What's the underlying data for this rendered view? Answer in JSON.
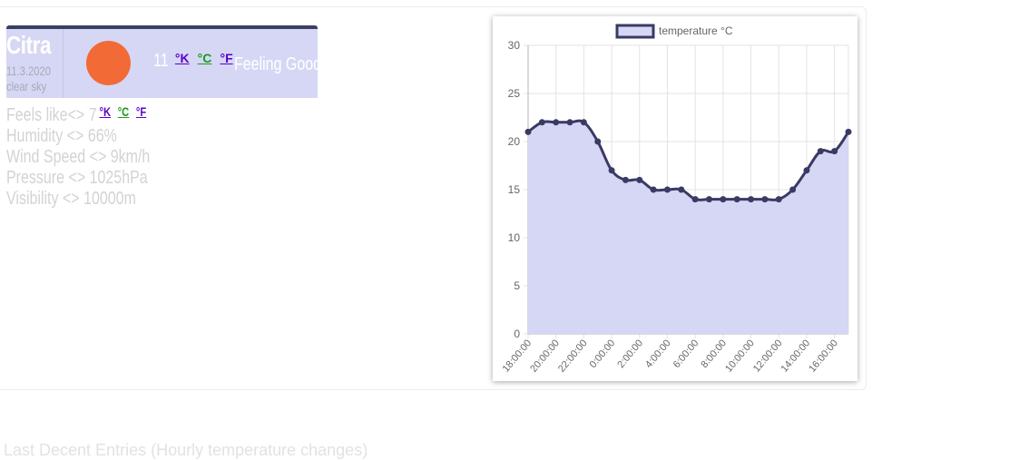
{
  "weather": {
    "city": "Citra",
    "date": "11.3.2020",
    "description": "clear sky",
    "icon": "sun-icon",
    "temperature": "11",
    "units": {
      "kelvin": "°K",
      "celsius": "°C",
      "fahrenheit": "°F"
    },
    "feeling": "Feeling Good"
  },
  "details": {
    "feels_like_label": "Feels like<> 7",
    "humidity": "Humidity <> 66%",
    "wind_speed": "Wind Speed <> 9km/h",
    "pressure": "Pressure <> 1025hPa",
    "visibility": "Visibility <> 10000m"
  },
  "footer": {
    "text": "Last Decent Entries (Hourly temperature changes)"
  },
  "colors": {
    "card_bg": "#d6d7f5",
    "card_border": "#3a3f63",
    "sun": "#f26a36",
    "line": "#3a3a64",
    "fill": "#d6d7f5",
    "celsius_link": "#1b9a1b",
    "kelvin_link": "#5a00c8"
  },
  "chart_data": {
    "type": "area",
    "legend": "temperature °C",
    "legend_position": "top",
    "grid": true,
    "ylim": [
      0,
      30
    ],
    "y_ticks": [
      0,
      5,
      10,
      15,
      20,
      25,
      30
    ],
    "x_tick_labels": [
      "18:00:00",
      "20:00:00",
      "22:00:00",
      "0:00:00",
      "2:00:00",
      "4:00:00",
      "6:00:00",
      "8:00:00",
      "10:00:00",
      "12:00:00",
      "14:00:00",
      "16:00:00"
    ],
    "series": [
      {
        "name": "temperature °C",
        "x": [
          "18:00:00",
          "19:00:00",
          "20:00:00",
          "21:00:00",
          "22:00:00",
          "23:00:00",
          "0:00:00",
          "1:00:00",
          "2:00:00",
          "3:00:00",
          "4:00:00",
          "5:00:00",
          "6:00:00",
          "7:00:00",
          "8:00:00",
          "9:00:00",
          "10:00:00",
          "11:00:00",
          "12:00:00",
          "13:00:00",
          "14:00:00",
          "15:00:00",
          "16:00:00",
          "17:00:00"
        ],
        "values": [
          21,
          22,
          22,
          22,
          22,
          20,
          17,
          16,
          16,
          15,
          15,
          15,
          14,
          14,
          14,
          14,
          14,
          14,
          14,
          15,
          17,
          19,
          19,
          21
        ]
      }
    ]
  }
}
